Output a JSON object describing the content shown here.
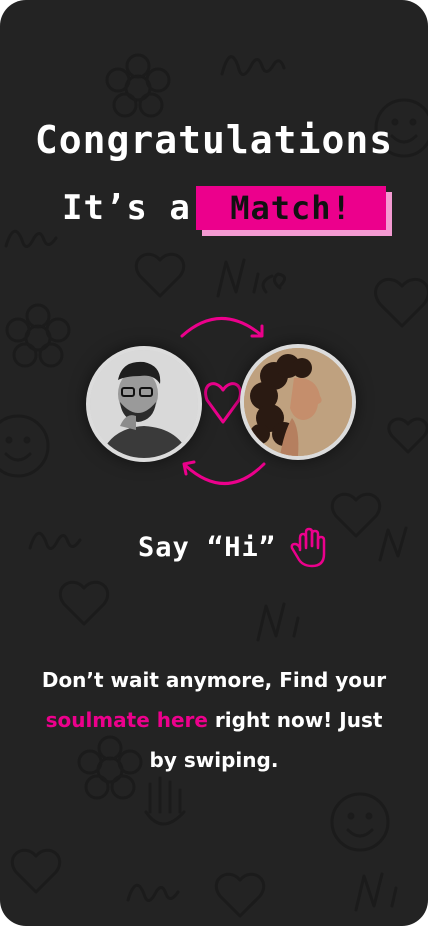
{
  "header": {
    "title": "Congratulations",
    "subtitle_prefix": "It’s a",
    "subtitle_highlight": "Match!"
  },
  "match": {
    "left_avatar": "avatar-man",
    "right_avatar": "avatar-woman",
    "center_icon": "heart-outline-icon"
  },
  "cta": {
    "label": "Say “Hi”",
    "icon": "raised-hand-icon"
  },
  "message": {
    "line1": "Don’t wait anymore, Find your",
    "highlight": "soulmate here",
    "line2_rest": " right now! Just",
    "line3": "by swiping."
  },
  "colors": {
    "background": "#232323",
    "accent": "#ec008c",
    "accent_shadow": "#f49ad2",
    "text": "#ffffff"
  }
}
